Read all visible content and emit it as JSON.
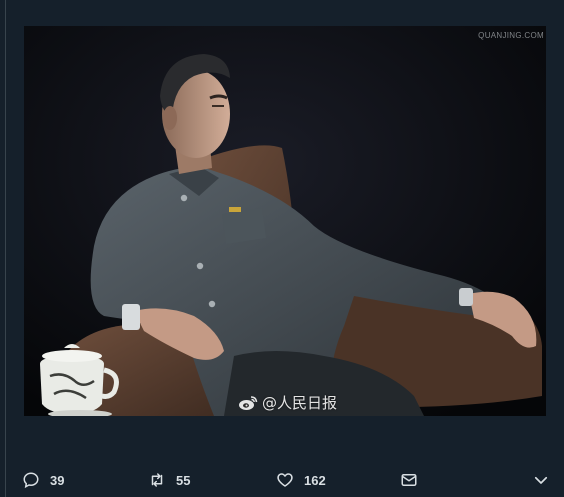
{
  "media": {
    "alt": "",
    "watermark_top": "QUANJING.COM",
    "watermark_bottom": "@人民日报"
  },
  "actions": {
    "reply_count": "39",
    "retweet_count": "55",
    "like_count": "162"
  },
  "icons": {
    "reply": "comment-bubble-icon",
    "retweet": "retweet-arrows-icon",
    "like": "heart-outline-icon",
    "share": "envelope-icon",
    "more": "chevron-down-icon",
    "weibo": "weibo-logo-icon"
  },
  "colors": {
    "background": "#15202b",
    "icon": "#d9dfe3"
  }
}
